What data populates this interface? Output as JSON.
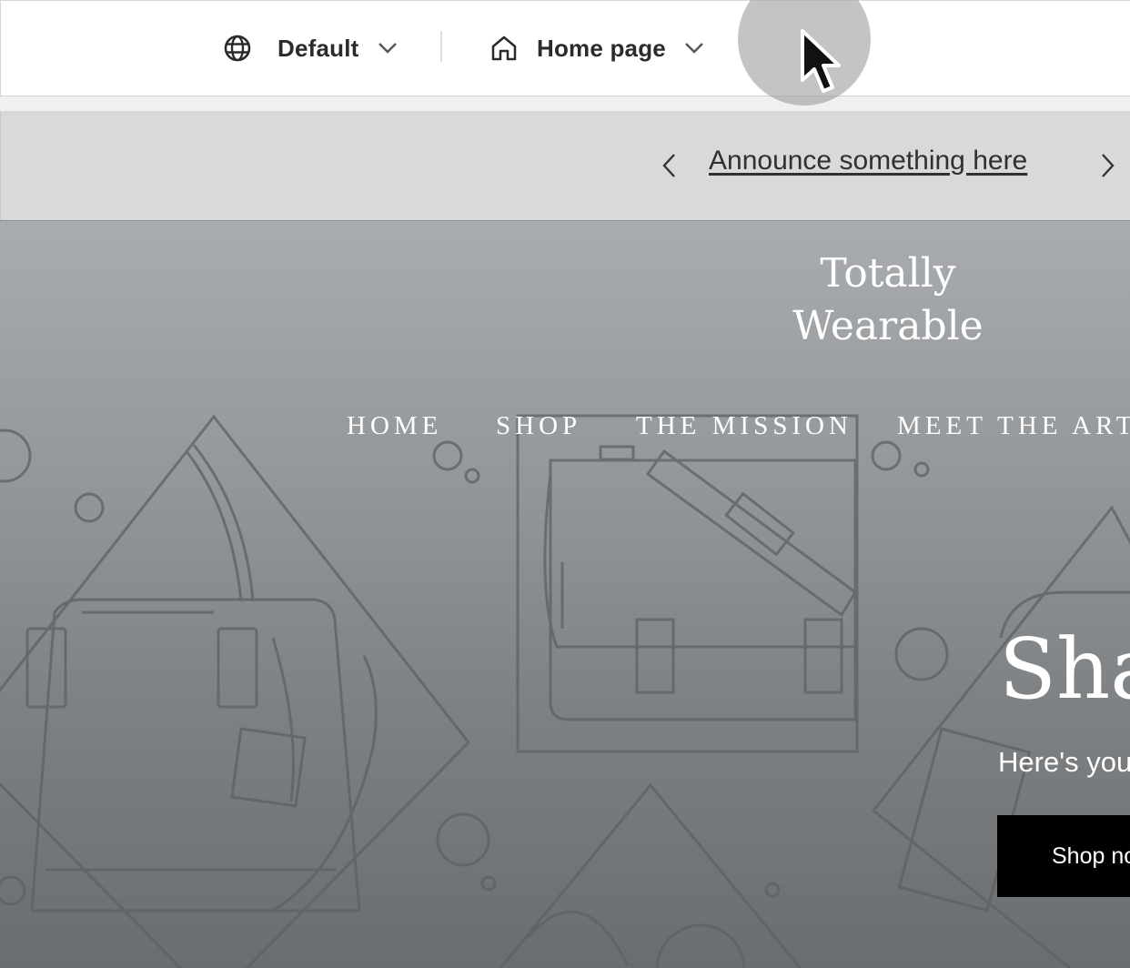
{
  "editor_bar": {
    "locale_label": "Default",
    "page_label": "Home page",
    "icons": {
      "locale": "globe-icon",
      "page": "home-icon",
      "dropdown": "chevron-down-icon"
    }
  },
  "announcement": {
    "text": "Announce something here",
    "icons": {
      "prev": "chevron-left-icon",
      "next": "chevron-right-icon"
    }
  },
  "store": {
    "brand_line_1": "Totally",
    "brand_line_2": "Wearable",
    "nav": [
      "HOME",
      "SHOP",
      "THE MISSION",
      "MEET THE ARTI"
    ]
  },
  "hero": {
    "title": "Sha",
    "subtitle": "Here's you",
    "button_label": "Shop no"
  },
  "colors": {
    "topbar_bg": "#ffffff",
    "announce_bg": "#d9d9d9",
    "hero_gradient_top": "#a9acae",
    "hero_gradient_bottom": "#6a6d6f",
    "button_bg": "#000000",
    "text_dark": "#2b2b2b"
  }
}
